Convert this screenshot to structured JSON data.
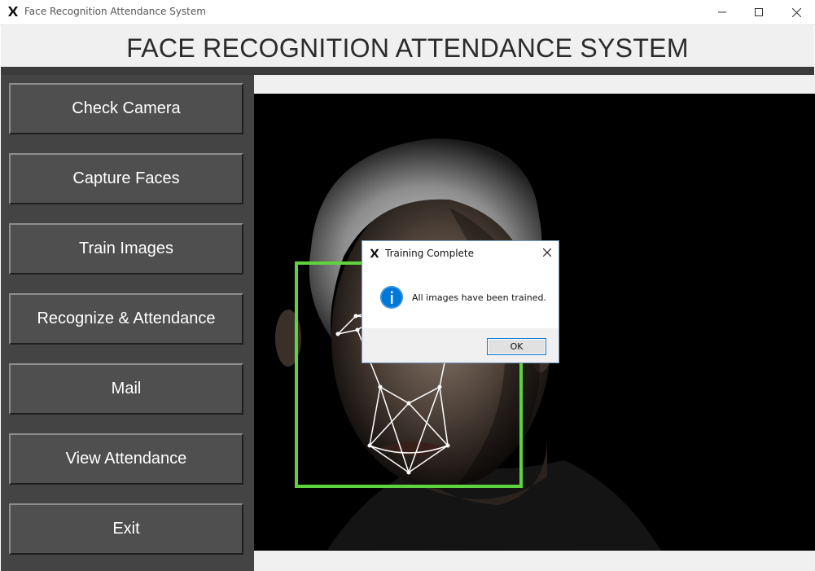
{
  "window": {
    "title": "Face Recognition Attendance System",
    "minimize_icon": "minimize-icon",
    "maximize_icon": "maximize-icon",
    "close_icon": "close-icon"
  },
  "header": {
    "title": "FACE RECOGNITION ATTENDANCE SYSTEM"
  },
  "sidebar": {
    "buttons": [
      {
        "label": "Check Camera"
      },
      {
        "label": "Capture Faces"
      },
      {
        "label": "Train Images"
      },
      {
        "label": "Recognize & Attendance"
      },
      {
        "label": "Mail"
      },
      {
        "label": "View Attendance"
      },
      {
        "label": "Exit"
      }
    ]
  },
  "dialog": {
    "title": "Training Complete",
    "message": "All images have been trained.",
    "ok_label": "OK",
    "icon": "info-icon"
  },
  "colors": {
    "sidebar_bg": "#444444",
    "button_bg": "#4f4f4f",
    "header_bar": "#3b3b3b",
    "face_box": "#5fd33f",
    "info_blue": "#0078d7"
  }
}
